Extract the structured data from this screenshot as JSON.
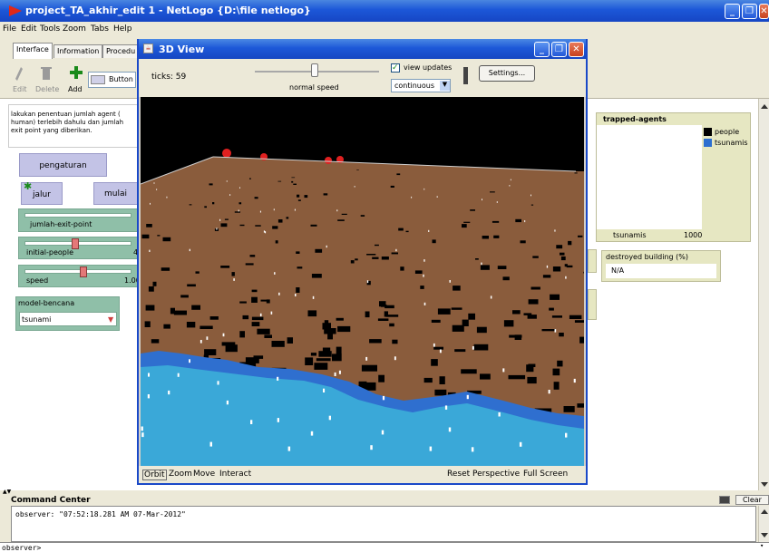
{
  "window": {
    "title": "project_TA_akhir_edit 1 - NetLogo {D:\\file netlogo}",
    "controls": [
      "_",
      "❐",
      "✕"
    ]
  },
  "menu": [
    "File",
    "Edit",
    "Tools",
    "Zoom",
    "Tabs",
    "Help"
  ],
  "tabs": [
    "Interface",
    "Information",
    "Procedu"
  ],
  "toolbar": {
    "edit": "Edit",
    "delete": "Delete",
    "add": "Add",
    "widget_select": "Button"
  },
  "interface": {
    "note": "lakukan penentuan jumlah agent ( human) terlebih dahulu dan jumlah exit point yang diberikan.",
    "btn_setup": "pengaturan",
    "btn_jalur": "jalur",
    "btn_mulai": "mulai",
    "slider_exit": "jumlah-exit-point",
    "slider_people": "initial-people",
    "slider_people_value": "4",
    "slider_speed": "speed",
    "slider_speed_value": "1.00",
    "chooser_label": "model-bencana",
    "chooser_value": "tsunami",
    "plot_title": "trapped-agents",
    "plot_legend": [
      "people",
      "tsunamis"
    ],
    "plot_xlabel": "tsunamis",
    "plot_xmax": "1000",
    "monitor_label": "destroyed building (%)",
    "monitor_value": "N/A"
  },
  "view3d": {
    "title": "3D View",
    "ticks": "ticks: 59",
    "speed_label": "normal speed",
    "view_updates": "view updates",
    "update_mode": "continuous",
    "settings": "Settings...",
    "bottom": {
      "orbit": "Orbit",
      "zoom": "Zoom",
      "move": "Move",
      "interact": "Interact",
      "reset": "Reset Perspective",
      "full": "Full Screen"
    }
  },
  "command_center": {
    "title": "Command Center",
    "clear": "Clear",
    "output": "observer: \"07:52:18.281 AM 07-Mar-2012\"",
    "prompt": "observer>"
  },
  "colors": {
    "terrain": "#8a5c3c",
    "water_light": "#3aa8d8",
    "water_dark": "#2f6fcf",
    "buildings": "#000000",
    "agents": "#ffffff",
    "flags": "#e02020",
    "legend_people": "#000000",
    "legend_tsunamis": "#2d6fd0"
  }
}
